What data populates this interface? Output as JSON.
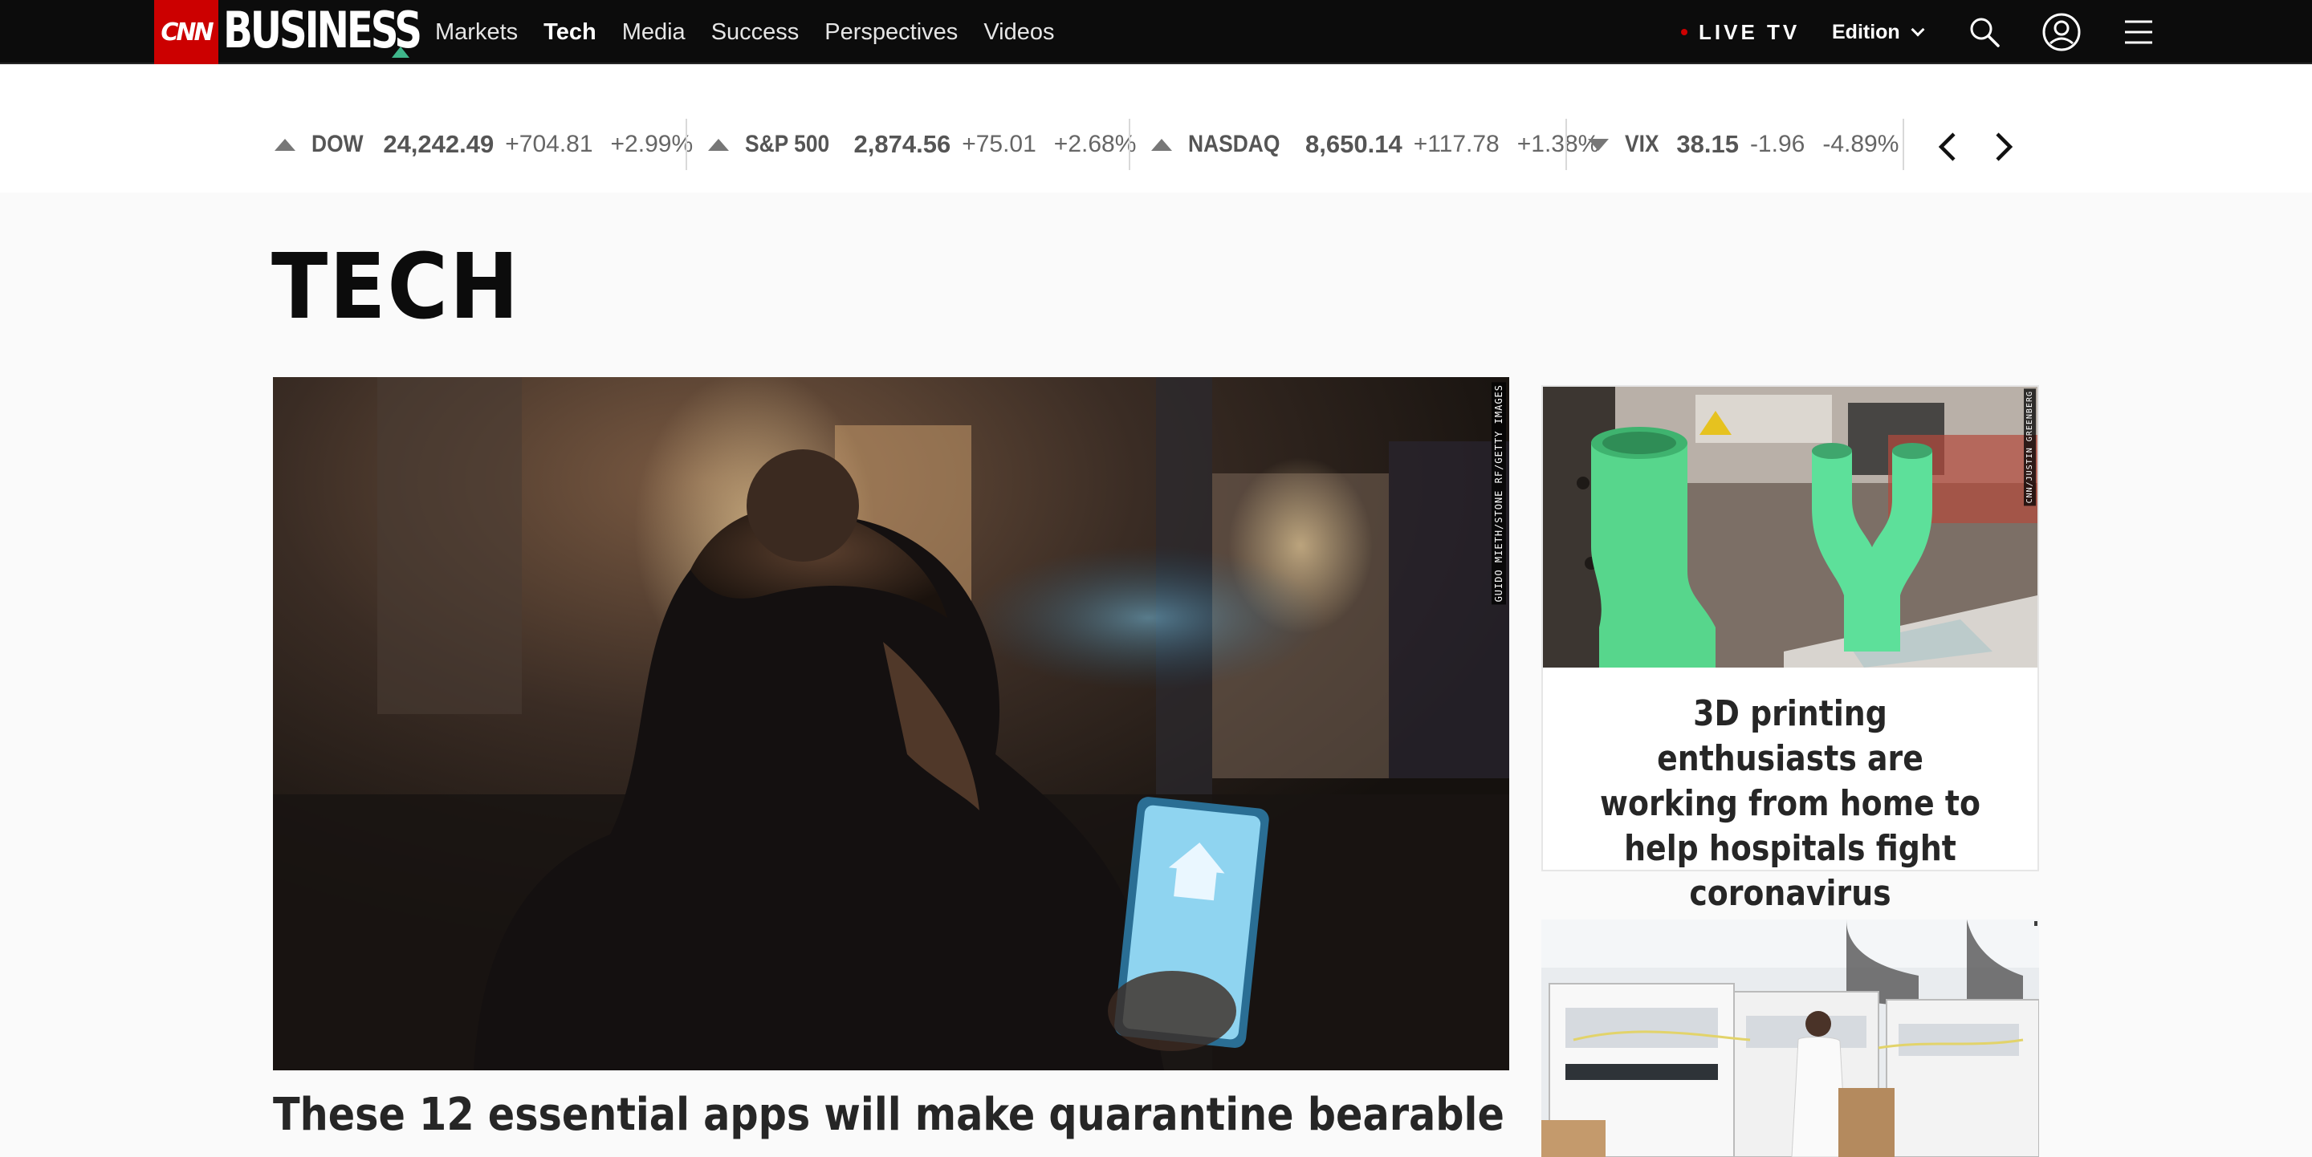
{
  "nav": {
    "logo_cnn": "CNN",
    "logo_business": "BUSINESS",
    "links": [
      "Markets",
      "Tech",
      "Media",
      "Success",
      "Perspectives",
      "Videos"
    ],
    "active": "Tech",
    "live_tv": "LIVE TV",
    "edition": "Edition",
    "icons": [
      "search-icon",
      "account-icon",
      "menu-icon"
    ]
  },
  "ticker": {
    "items": [
      {
        "name": "DOW",
        "value": "24,242.49",
        "change": "+704.81",
        "percent": "+2.99%",
        "direction": "up"
      },
      {
        "name": "S&P 500",
        "value": "2,874.56",
        "change": "+75.01",
        "percent": "+2.68%",
        "direction": "up"
      },
      {
        "name": "NASDAQ",
        "value": "8,650.14",
        "change": "+117.78",
        "percent": "+1.38%",
        "direction": "up"
      },
      {
        "name": "VIX",
        "value": "38.15",
        "change": "-1.96",
        "percent": "-4.89%",
        "direction": "down"
      }
    ]
  },
  "section": {
    "title": "TECH"
  },
  "hero": {
    "credit": "GUIDO MIETH/STONE RF/GETTY IMAGES",
    "headline": "These 12 essential apps will make quarantine bearable"
  },
  "cards": [
    {
      "credit": "CNN/JUSTIN GREENBERG",
      "headline": "3D printing enthusiasts are working from home to help hospitals fight coronavirus"
    },
    {
      "credit": ""
    }
  ],
  "colors": {
    "nav_bg": "#0c0c0c",
    "cnn_red": "#cc0000",
    "accent_green": "#3fb58a"
  }
}
